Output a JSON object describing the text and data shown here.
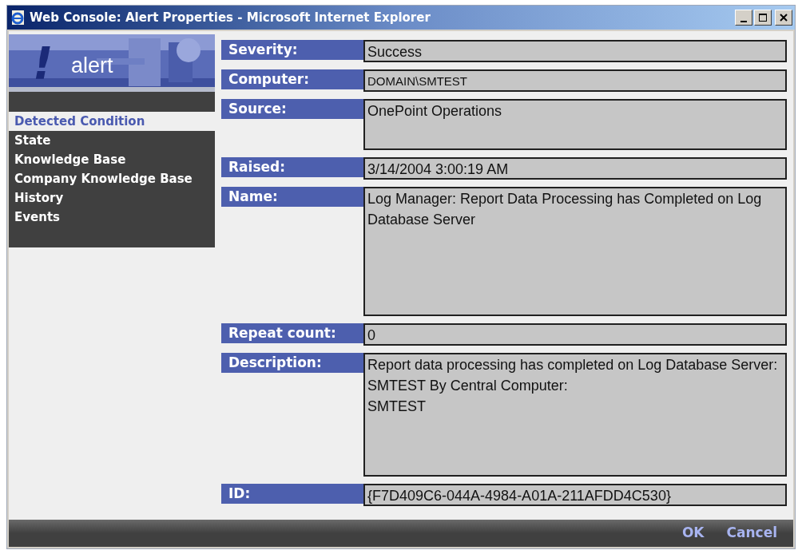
{
  "window": {
    "title": "Web Console: Alert Properties - Microsoft Internet Explorer"
  },
  "banner": {
    "mark": "!",
    "text": "alert"
  },
  "sidebar": {
    "items": [
      {
        "label": "Detected Condition",
        "selected": true
      },
      {
        "label": "State",
        "selected": false
      },
      {
        "label": "Knowledge Base",
        "selected": false
      },
      {
        "label": "Company Knowledge Base",
        "selected": false
      },
      {
        "label": "History",
        "selected": false
      },
      {
        "label": "Events",
        "selected": false
      }
    ]
  },
  "fields": [
    {
      "label": "Severity:",
      "value": "Success"
    },
    {
      "label": "Computer:",
      "value": "DOMAIN\\SMTEST"
    },
    {
      "label": "Source:",
      "value": "OnePoint Operations"
    },
    {
      "label": "Raised:",
      "value": "3/14/2004 3:00:19 AM"
    },
    {
      "label": "Name:",
      "value": "Log Manager: Report Data Processing has Completed on Log Database Server"
    },
    {
      "label": "Repeat count:",
      "value": "0"
    },
    {
      "label": "Description:",
      "value": "Report data processing has completed on Log Database Server: SMTEST By Central Computer:\nSMTEST"
    },
    {
      "label": "ID:",
      "value": "{F7D409C6-044A-4984-A01A-211AFDD4C530}"
    }
  ],
  "buttons": [
    "OK",
    "Cancel"
  ]
}
